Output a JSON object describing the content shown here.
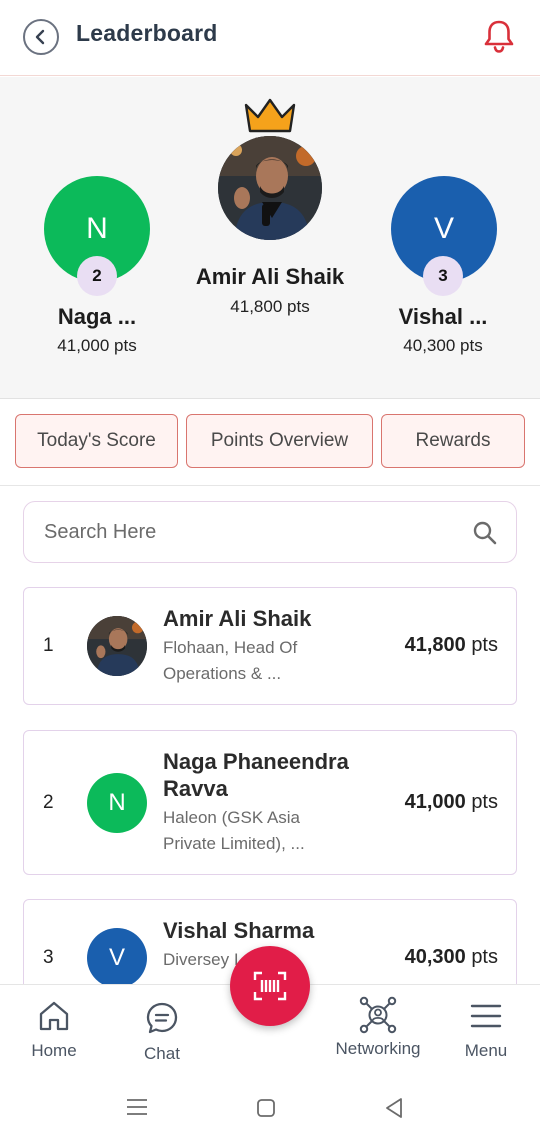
{
  "header": {
    "title": "Leaderboard"
  },
  "podium": {
    "first": {
      "name": "Amir Ali Shaik",
      "points": "41,800 pts"
    },
    "second": {
      "initial": "N",
      "rank": "2",
      "name": "Naga ...",
      "points": "41,000 pts",
      "color": "#0cba5a"
    },
    "third": {
      "initial": "V",
      "rank": "3",
      "name": "Vishal ...",
      "points": "40,300 pts",
      "color": "#1a5fae"
    }
  },
  "tabs": [
    "Today's Score",
    "Points Overview",
    "Rewards"
  ],
  "search": {
    "placeholder": "Search Here"
  },
  "leaderboard": [
    {
      "rank": "1",
      "name": "Amir Ali Shaik",
      "org_line1": "Flohaan, Head Of",
      "org_line2": "Operations & ...",
      "points": "41,800",
      "unit": "pts"
    },
    {
      "rank": "2",
      "initial": "N",
      "name_line1": "Naga Phaneendra",
      "name_line2": "Ravva",
      "org_line1": "Haleon (GSK Asia",
      "org_line2": "Private Limited), ...",
      "points": "41,000",
      "unit": "pts"
    },
    {
      "rank": "3",
      "initial": "V",
      "name": "Vishal Sharma",
      "org_line1": "Diversey I",
      "points": "40,300",
      "unit": "pts"
    }
  ],
  "nav": {
    "home": "Home",
    "chat": "Chat",
    "networking": "Networking",
    "menu": "Menu"
  },
  "colors": {
    "accent": "#e11d48",
    "green": "#0cba5a",
    "blue": "#1a5fae",
    "crown": "#f5a21b"
  }
}
